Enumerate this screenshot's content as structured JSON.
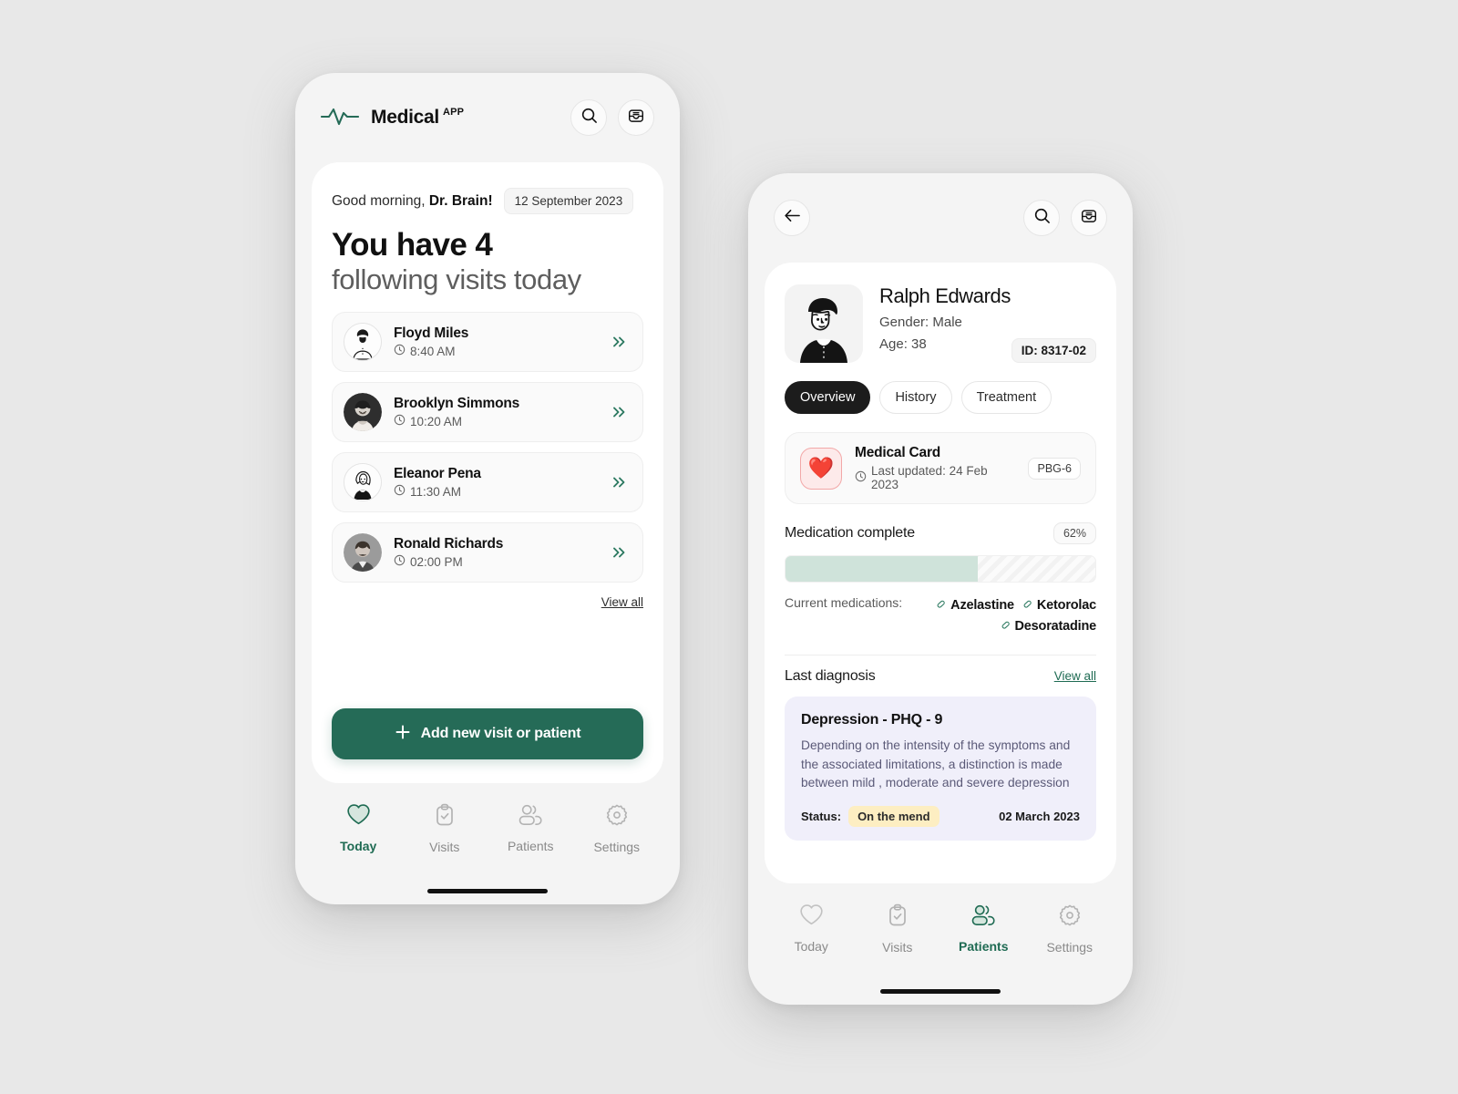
{
  "brand": {
    "name": "Medical",
    "superscript": "APP",
    "accent": "#256b57",
    "logo_icon": "heartbeat-line-icon"
  },
  "home": {
    "search_icon": "search-icon",
    "inbox_icon": "inbox-icon",
    "greeting": "Good morning,",
    "doctor": "Dr. Brain!",
    "date": "12 September 2023",
    "headline_line1": "You have 4",
    "headline_line2": "following visits today",
    "visits": [
      {
        "name": "Floyd Miles",
        "time": "8:40 AM",
        "clock_icon": "clock-icon",
        "chevron_icon": "double-chevron-right-icon"
      },
      {
        "name": "Brooklyn Simmons",
        "time": "10:20 AM",
        "clock_icon": "clock-icon",
        "chevron_icon": "double-chevron-right-icon"
      },
      {
        "name": "Eleanor Pena",
        "time": "11:30 AM",
        "clock_icon": "clock-icon",
        "chevron_icon": "double-chevron-right-icon"
      },
      {
        "name": "Ronald Richards",
        "time": "02:00 PM",
        "clock_icon": "clock-icon",
        "chevron_icon": "double-chevron-right-icon"
      }
    ],
    "view_all": "View all",
    "cta": "Add new visit or patient",
    "cta_icon": "plus-icon",
    "nav": [
      {
        "label": "Today",
        "icon": "heart-icon",
        "active": true
      },
      {
        "label": "Visits",
        "icon": "clipboard-check-icon",
        "active": false
      },
      {
        "label": "Patients",
        "icon": "people-icon",
        "active": false
      },
      {
        "label": "Settings",
        "icon": "gear-icon",
        "active": false
      }
    ]
  },
  "detail": {
    "back_icon": "arrow-left-icon",
    "search_icon": "search-icon",
    "inbox_icon": "inbox-icon",
    "patient": {
      "name": "Ralph Edwards",
      "gender": "Gender: Male",
      "age": "Age: 38",
      "id": "ID: 8317-02",
      "photo_icon": "patient-portrait-icon"
    },
    "tabs": [
      {
        "label": "Overview",
        "selected": true
      },
      {
        "label": "History",
        "selected": false
      },
      {
        "label": "Treatment",
        "selected": false
      }
    ],
    "medical_card": {
      "title": "Medical Card",
      "updated": "Last updated: 24 Feb 2023",
      "code": "PBG-6",
      "heart_icon": "red-heart-icon",
      "clock_icon": "clock-icon"
    },
    "medication": {
      "title": "Medication complete",
      "percent_label": "62%",
      "percent_value": 62,
      "fill_color": "#cfe3da",
      "list_label": "Current medications:",
      "items": [
        "Azelastine",
        "Ketorolac",
        "Desoratadine"
      ],
      "item_icon": "capsule-icon"
    },
    "diagnosis": {
      "section_title": "Last diagnosis",
      "view_all": "View all",
      "name": "Depression - PHQ - 9",
      "body": "Depending on the intensity of the symptoms and the associated limitations, a distinction is made between mild , moderate and severe depression",
      "status_label": "Status:",
      "status_value": "On the mend",
      "date": "02 March 2023"
    },
    "nav": [
      {
        "label": "Today",
        "icon": "heart-icon",
        "active": false
      },
      {
        "label": "Visits",
        "icon": "clipboard-check-icon",
        "active": false
      },
      {
        "label": "Patients",
        "icon": "people-icon",
        "active": true
      },
      {
        "label": "Settings",
        "icon": "gear-icon",
        "active": false
      }
    ]
  }
}
